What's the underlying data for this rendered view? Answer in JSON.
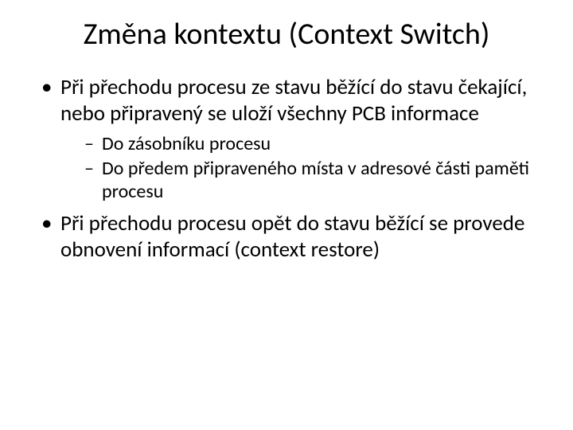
{
  "title": "Změna kontextu (Context Switch)",
  "bullets": [
    {
      "text": "Při přechodu procesu ze stavu běžící do stavu čekající, nebo připravený se uloží všechny PCB informace",
      "sub": [
        {
          "text": "Do zásobníku procesu"
        },
        {
          "text": "Do předem připraveného místa v adresové části paměti procesu"
        }
      ]
    },
    {
      "text": "Při přechodu procesu opět do stavu běžící se provede obnovení informací (context restore)",
      "sub": []
    }
  ]
}
